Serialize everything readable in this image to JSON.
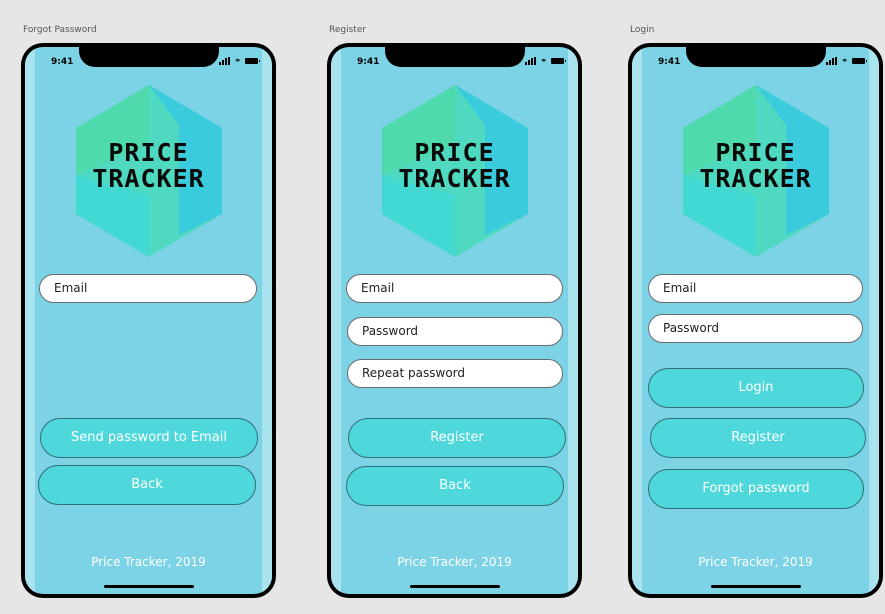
{
  "artboards": [
    {
      "title": "Forgot Password",
      "status_time": "9:41",
      "logo_line1": "PRICE",
      "logo_line2": "TRACKER",
      "fields": [
        "Email"
      ],
      "buttons": [
        "Send password to Email",
        "Back"
      ],
      "footer": "Price Tracker, 2019"
    },
    {
      "title": "Register",
      "status_time": "9:41",
      "logo_line1": "PRICE",
      "logo_line2": "TRACKER",
      "fields": [
        "Email",
        "Password",
        "Repeat password"
      ],
      "buttons": [
        "Register",
        "Back"
      ],
      "footer": "Price Tracker, 2019"
    },
    {
      "title": "Login",
      "status_time": "9:41",
      "logo_line1": "PRICE",
      "logo_line2": "TRACKER",
      "fields": [
        "Email",
        "Password"
      ],
      "buttons": [
        "Login",
        "Register",
        "Forgot password"
      ],
      "footer": "Price Tracker, 2019"
    }
  ],
  "colors": {
    "background": "#e6e6e6",
    "screen": "#7dd3e6",
    "button": "#4fd8dc",
    "hex_green": "#4fd9a8",
    "hex_blue": "#33c6e6"
  }
}
